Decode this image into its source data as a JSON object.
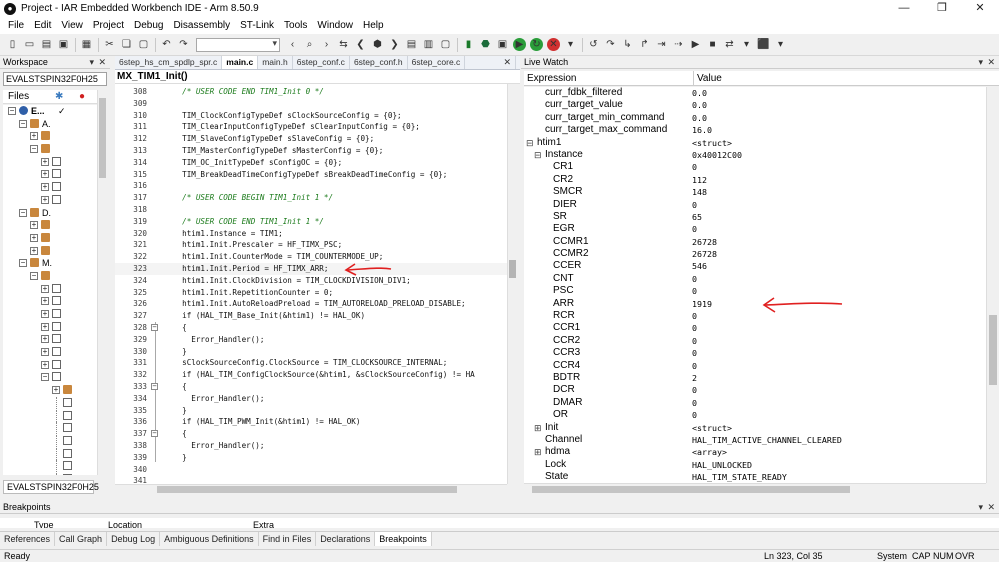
{
  "window": {
    "title": "Project - IAR Embedded Workbench IDE - Arm 8.50.9",
    "app_icon": "iar-logo-icon"
  },
  "menu": [
    "File",
    "Edit",
    "View",
    "Project",
    "Debug",
    "Disassembly",
    "ST-Link",
    "Tools",
    "Window",
    "Help"
  ],
  "workspace": {
    "title": "Workspace",
    "config": "EVALSTSPIN32F0H25",
    "files_label": "Files",
    "tree": [
      {
        "depth": 0,
        "expander": "minus",
        "icon": "project",
        "label": "E..."
      },
      {
        "depth": 1,
        "expander": "minus",
        "icon": "folder",
        "label": "A."
      },
      {
        "depth": 2,
        "expander": "plus",
        "icon": "folder",
        "label": ""
      },
      {
        "depth": 2,
        "expander": "minus",
        "icon": "folder",
        "label": ""
      },
      {
        "depth": 3,
        "expander": "plus",
        "icon": "file",
        "label": ""
      },
      {
        "depth": 3,
        "expander": "plus",
        "icon": "file",
        "label": ""
      },
      {
        "depth": 3,
        "expander": "plus",
        "icon": "file",
        "label": ""
      },
      {
        "depth": 3,
        "expander": "plus",
        "icon": "file",
        "label": ""
      },
      {
        "depth": 1,
        "expander": "minus",
        "icon": "folder",
        "label": "D."
      },
      {
        "depth": 2,
        "expander": "plus",
        "icon": "folder",
        "label": ""
      },
      {
        "depth": 2,
        "expander": "plus",
        "icon": "folder",
        "label": ""
      },
      {
        "depth": 2,
        "expander": "plus",
        "icon": "folder",
        "label": ""
      },
      {
        "depth": 1,
        "expander": "minus",
        "icon": "folder",
        "label": "M."
      },
      {
        "depth": 2,
        "expander": "minus",
        "icon": "folder",
        "label": ""
      },
      {
        "depth": 3,
        "expander": "plus",
        "icon": "file",
        "label": ""
      },
      {
        "depth": 3,
        "expander": "plus",
        "icon": "file",
        "label": ""
      },
      {
        "depth": 3,
        "expander": "plus",
        "icon": "file",
        "label": ""
      },
      {
        "depth": 3,
        "expander": "plus",
        "icon": "file",
        "label": ""
      },
      {
        "depth": 3,
        "expander": "plus",
        "icon": "file",
        "label": ""
      },
      {
        "depth": 3,
        "expander": "plus",
        "icon": "file",
        "label": ""
      },
      {
        "depth": 3,
        "expander": "plus",
        "icon": "file",
        "label": ""
      },
      {
        "depth": 3,
        "expander": "minus",
        "icon": "file",
        "label": ""
      },
      {
        "depth": 4,
        "expander": "plus",
        "icon": "folder",
        "label": ""
      },
      {
        "depth": 4,
        "expander": "none",
        "icon": "file",
        "label": ""
      },
      {
        "depth": 4,
        "expander": "none",
        "icon": "file",
        "label": ""
      },
      {
        "depth": 4,
        "expander": "none",
        "icon": "file",
        "label": ""
      },
      {
        "depth": 4,
        "expander": "none",
        "icon": "file",
        "label": ""
      },
      {
        "depth": 4,
        "expander": "none",
        "icon": "file",
        "label": ""
      },
      {
        "depth": 4,
        "expander": "none",
        "icon": "file",
        "label": ""
      },
      {
        "depth": 4,
        "expander": "none",
        "icon": "file",
        "label": ""
      }
    ],
    "footer": "EVALSTSPIN32F0H25"
  },
  "editor": {
    "tabs": [
      {
        "label": "6step_hs_cm_spdlp_spr.c",
        "active": false
      },
      {
        "label": "main.c",
        "active": true
      },
      {
        "label": "main.h",
        "active": false
      },
      {
        "label": "6step_conf.c",
        "active": false
      },
      {
        "label": "6step_conf.h",
        "active": false
      },
      {
        "label": "6step_core.c",
        "active": false
      }
    ],
    "function": "MX_TIM1_Init()",
    "cursor_line": 323,
    "lines": [
      {
        "n": 308,
        "t": "  /* USER CODE END TIM1_Init 0 */",
        "c": true,
        "f": ""
      },
      {
        "n": 309,
        "t": "",
        "c": false,
        "f": ""
      },
      {
        "n": 310,
        "t": "  TIM_ClockConfigTypeDef sClockSourceConfig = {0};",
        "c": false,
        "f": ""
      },
      {
        "n": 311,
        "t": "  TIM_ClearInputConfigTypeDef sClearInputConfig = {0};",
        "c": false,
        "f": ""
      },
      {
        "n": 312,
        "t": "  TIM_SlaveConfigTypeDef sSlaveConfig = {0};",
        "c": false,
        "f": ""
      },
      {
        "n": 313,
        "t": "  TIM_MasterConfigTypeDef sMasterConfig = {0};",
        "c": false,
        "f": ""
      },
      {
        "n": 314,
        "t": "  TIM_OC_InitTypeDef sConfigOC = {0};",
        "c": false,
        "f": ""
      },
      {
        "n": 315,
        "t": "  TIM_BreakDeadTimeConfigTypeDef sBreakDeadTimeConfig = {0};",
        "c": false,
        "f": ""
      },
      {
        "n": 316,
        "t": "",
        "c": false,
        "f": ""
      },
      {
        "n": 317,
        "t": "  /* USER CODE BEGIN TIM1_Init 1 */",
        "c": true,
        "f": ""
      },
      {
        "n": 318,
        "t": "",
        "c": false,
        "f": ""
      },
      {
        "n": 319,
        "t": "  /* USER CODE END TIM1_Init 1 */",
        "c": true,
        "f": ""
      },
      {
        "n": 320,
        "t": "  htim1.Instance = TIM1;",
        "c": false,
        "f": ""
      },
      {
        "n": 321,
        "t": "  htim1.Init.Prescaler = HF_TIMX_PSC;",
        "c": false,
        "f": ""
      },
      {
        "n": 322,
        "t": "  htim1.Init.CounterMode = TIM_COUNTERMODE_UP;",
        "c": false,
        "f": ""
      },
      {
        "n": 323,
        "t": "  htim1.Init.Period = HF_TIMX_ARR;",
        "c": false,
        "f": ""
      },
      {
        "n": 324,
        "t": "  htim1.Init.ClockDivision = TIM_CLOCKDIVISION_DIV1;",
        "c": false,
        "f": ""
      },
      {
        "n": 325,
        "t": "  htim1.Init.RepetitionCounter = 0;",
        "c": false,
        "f": ""
      },
      {
        "n": 326,
        "t": "  htim1.Init.AutoReloadPreload = TIM_AUTORELOAD_PRELOAD_DISABLE;",
        "c": false,
        "f": ""
      },
      {
        "n": 327,
        "t": "  if (HAL_TIM_Base_Init(&htim1) != HAL_OK)",
        "c": false,
        "f": ""
      },
      {
        "n": 328,
        "t": "  {",
        "c": false,
        "f": "minus"
      },
      {
        "n": 329,
        "t": "    Error_Handler();",
        "c": false,
        "f": ""
      },
      {
        "n": 330,
        "t": "  }",
        "c": false,
        "f": ""
      },
      {
        "n": 331,
        "t": "  sClockSourceConfig.ClockSource = TIM_CLOCKSOURCE_INTERNAL;",
        "c": false,
        "f": ""
      },
      {
        "n": 332,
        "t": "  if (HAL_TIM_ConfigClockSource(&htim1, &sClockSourceConfig) != HA",
        "c": false,
        "f": ""
      },
      {
        "n": 333,
        "t": "  {",
        "c": false,
        "f": "minus"
      },
      {
        "n": 334,
        "t": "    Error_Handler();",
        "c": false,
        "f": ""
      },
      {
        "n": 335,
        "t": "  }",
        "c": false,
        "f": ""
      },
      {
        "n": 336,
        "t": "  if (HAL_TIM_PWM_Init(&htim1) != HAL_OK)",
        "c": false,
        "f": ""
      },
      {
        "n": 337,
        "t": "  {",
        "c": false,
        "f": "minus"
      },
      {
        "n": 338,
        "t": "    Error_Handler();",
        "c": false,
        "f": ""
      },
      {
        "n": 339,
        "t": "  }",
        "c": false,
        "f": ""
      },
      {
        "n": 340,
        "t": "",
        "c": false,
        "f": ""
      },
      {
        "n": 341,
        "t": "",
        "c": false,
        "f": ""
      }
    ]
  },
  "live_watch": {
    "title": "Live Watch",
    "col_expression": "Expression",
    "col_value": "Value",
    "rows": [
      {
        "d": 1,
        "e": "",
        "name": "curr_fdbk_filtered",
        "value": "0.0"
      },
      {
        "d": 1,
        "e": "",
        "name": "curr_target_value",
        "value": "0.0"
      },
      {
        "d": 1,
        "e": "",
        "name": "curr_target_min_command",
        "value": "0.0"
      },
      {
        "d": 1,
        "e": "",
        "name": "curr_target_max_command",
        "value": "16.0"
      },
      {
        "d": 0,
        "e": "minus",
        "name": "htim1",
        "value": "<struct>"
      },
      {
        "d": 1,
        "e": "minus",
        "name": "Instance",
        "value": "0x40012C00"
      },
      {
        "d": 2,
        "e": "",
        "name": "CR1",
        "value": "0"
      },
      {
        "d": 2,
        "e": "",
        "name": "CR2",
        "value": "112"
      },
      {
        "d": 2,
        "e": "",
        "name": "SMCR",
        "value": "148"
      },
      {
        "d": 2,
        "e": "",
        "name": "DIER",
        "value": "0"
      },
      {
        "d": 2,
        "e": "",
        "name": "SR",
        "value": "65"
      },
      {
        "d": 2,
        "e": "",
        "name": "EGR",
        "value": "0"
      },
      {
        "d": 2,
        "e": "",
        "name": "CCMR1",
        "value": "26728"
      },
      {
        "d": 2,
        "e": "",
        "name": "CCMR2",
        "value": "26728"
      },
      {
        "d": 2,
        "e": "",
        "name": "CCER",
        "value": "546"
      },
      {
        "d": 2,
        "e": "",
        "name": "CNT",
        "value": "0"
      },
      {
        "d": 2,
        "e": "",
        "name": "PSC",
        "value": "0"
      },
      {
        "d": 2,
        "e": "",
        "name": "ARR",
        "value": "1919"
      },
      {
        "d": 2,
        "e": "",
        "name": "RCR",
        "value": "0"
      },
      {
        "d": 2,
        "e": "",
        "name": "CCR1",
        "value": "0"
      },
      {
        "d": 2,
        "e": "",
        "name": "CCR2",
        "value": "0"
      },
      {
        "d": 2,
        "e": "",
        "name": "CCR3",
        "value": "0"
      },
      {
        "d": 2,
        "e": "",
        "name": "CCR4",
        "value": "0"
      },
      {
        "d": 2,
        "e": "",
        "name": "BDTR",
        "value": "2"
      },
      {
        "d": 2,
        "e": "",
        "name": "DCR",
        "value": "0"
      },
      {
        "d": 2,
        "e": "",
        "name": "DMAR",
        "value": "0"
      },
      {
        "d": 2,
        "e": "",
        "name": "OR",
        "value": "0"
      },
      {
        "d": 1,
        "e": "plus",
        "name": "Init",
        "value": "<struct>"
      },
      {
        "d": 1,
        "e": "",
        "name": "Channel",
        "value": "HAL_TIM_ACTIVE_CHANNEL_CLEARED"
      },
      {
        "d": 1,
        "e": "plus",
        "name": "hdma",
        "value": "<array>"
      },
      {
        "d": 1,
        "e": "",
        "name": "Lock",
        "value": "HAL_UNLOCKED"
      },
      {
        "d": 1,
        "e": "",
        "name": "State",
        "value": "HAL_TIM_STATE_READY"
      }
    ]
  },
  "breakpoints": {
    "title": "Breakpoints",
    "columns": [
      "Type",
      "Location",
      "Extra"
    ],
    "tabs": [
      {
        "label": "References",
        "active": false
      },
      {
        "label": "Call Graph",
        "active": false
      },
      {
        "label": "Debug Log",
        "active": false
      },
      {
        "label": "Ambiguous Definitions",
        "active": false
      },
      {
        "label": "Find in Files",
        "active": false
      },
      {
        "label": "Declarations",
        "active": false
      },
      {
        "label": "Breakpoints",
        "active": true
      }
    ]
  },
  "status": {
    "left": "Ready",
    "position": "Ln 323, Col 35",
    "mode": "System",
    "caps": "CAP",
    "num": "NUM",
    "ovr": "OVR"
  },
  "annotation_color": "#e02020"
}
